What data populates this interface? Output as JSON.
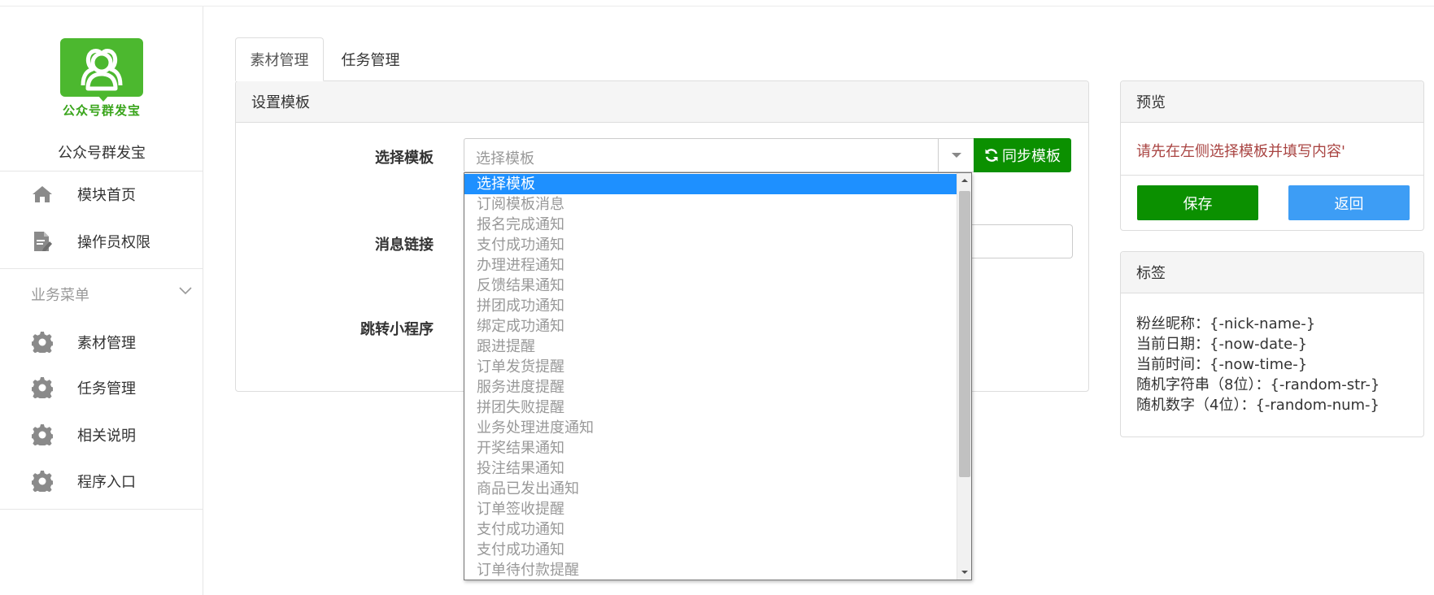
{
  "brand": {
    "logo_text": "公众号群发宝",
    "app_name": "公众号群发宝",
    "logo_color": "#4cb82f"
  },
  "sidebar": {
    "top_items": [
      {
        "label": "模块首页",
        "icon": "home-icon"
      },
      {
        "label": "操作员权限",
        "icon": "document-edit-icon"
      }
    ],
    "section_label": "业务菜单",
    "section_items": [
      {
        "label": "素材管理",
        "icon": "gear-icon"
      },
      {
        "label": "任务管理",
        "icon": "gear-icon"
      },
      {
        "label": "相关说明",
        "icon": "gear-icon"
      },
      {
        "label": "程序入口",
        "icon": "gear-icon"
      }
    ]
  },
  "tabs": [
    {
      "label": "素材管理",
      "active": true
    },
    {
      "label": "任务管理",
      "active": false
    }
  ],
  "main_panel": {
    "title": "设置模板",
    "fields": {
      "template_label": "选择模板",
      "link_label": "消息链接",
      "miniprogram_label": "跳转小程序"
    },
    "select": {
      "value": "选择模板"
    },
    "sync_button": "同步模板",
    "dropdown_options": [
      "选择模板",
      "订阅模板消息",
      "报名完成通知",
      "支付成功通知",
      "办理进程通知",
      "反馈结果通知",
      "拼团成功通知",
      "绑定成功通知",
      "跟进提醒",
      "订单发货提醒",
      "服务进度提醒",
      "拼团失败提醒",
      "业务处理进度通知",
      "开奖结果通知",
      "投注结果通知",
      "商品已发出通知",
      "订单签收提醒",
      "支付成功通知",
      "支付成功通知",
      "订单待付款提醒"
    ],
    "selected_index": 0
  },
  "preview_panel": {
    "title": "预览",
    "message": "请先在左侧选择模板并填写内容'",
    "save_button": "保存",
    "back_button": "返回"
  },
  "tags_panel": {
    "title": "标签",
    "tags": [
      "粉丝昵称：{-nick-name-}",
      "当前日期：{-now-date-}",
      "当前时间：{-now-time-}",
      "随机字符串（8位）：{-random-str-}",
      "随机数字（4位）：{-random-num-}"
    ]
  },
  "colors": {
    "primary_green": "#0b9000",
    "primary_blue": "#3d9df5",
    "selected_option": "#1e90ff",
    "warning_text": "#a94442"
  }
}
